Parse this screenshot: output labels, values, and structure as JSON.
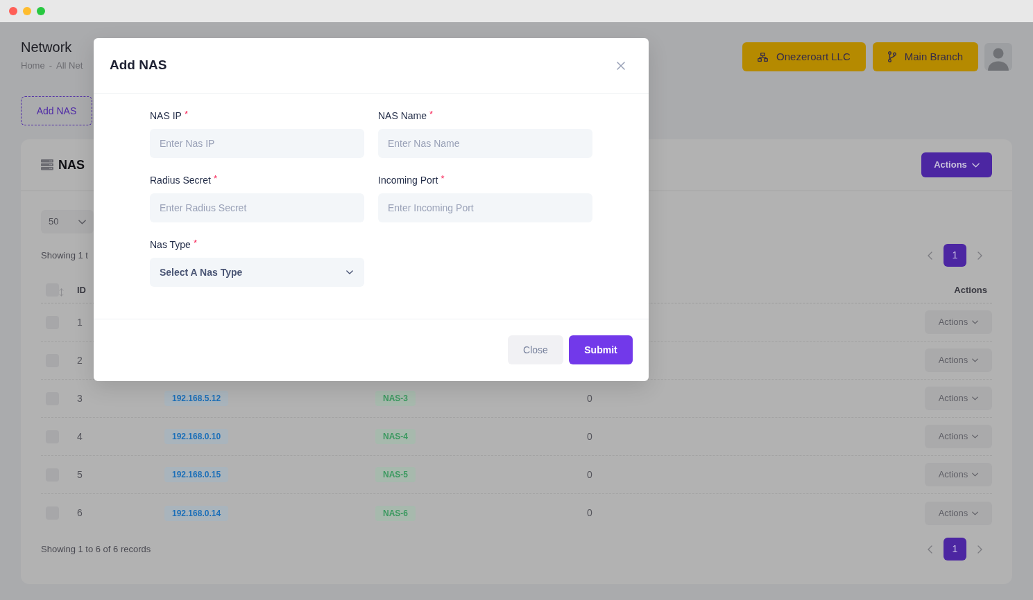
{
  "page": {
    "title": "Network",
    "breadcrumb": {
      "items": [
        "Home",
        "All Net"
      ],
      "separator": "-"
    }
  },
  "header_buttons": [
    {
      "label": "Onezeroart LLC"
    },
    {
      "label": "Main Branch"
    }
  ],
  "add_button": {
    "label": "Add NAS"
  },
  "card": {
    "title": "NAS",
    "actions_button": "Actions",
    "page_size": "50",
    "summary_top": "Showing 1 t",
    "pagination_top": [
      {
        "label": "1",
        "selected": true
      }
    ],
    "table": {
      "select_all_checked": false,
      "header": {
        "id": "ID",
        "actions": "Actions"
      },
      "rows": [
        {
          "id": "1",
          "checked": false,
          "actions": "Actions"
        },
        {
          "id": "2",
          "checked": false,
          "actions": "Actions"
        },
        {
          "id": "3",
          "checked": false,
          "column_3": "192.168.5.12",
          "column_4": "NAS-3",
          "column_5": "0",
          "actions": "Actions"
        },
        {
          "id": "4",
          "checked": false,
          "column_3": "192.168.0.10",
          "column_4": "NAS-4",
          "column_5": "0",
          "actions": "Actions"
        },
        {
          "id": "5",
          "checked": false,
          "column_3": "192.168.0.15",
          "column_4": "NAS-5",
          "column_5": "0",
          "actions": "Actions"
        },
        {
          "id": "6",
          "checked": false,
          "column_3": "192.168.0.14",
          "column_4": "NAS-6",
          "column_5": "0",
          "actions": "Actions"
        }
      ]
    },
    "summary_bottom": "Showing 1 to 6 of 6 records",
    "pagination_bottom": [
      {
        "label": "1",
        "selected": true
      }
    ]
  },
  "modal": {
    "title": "Add NAS",
    "fields": [
      {
        "kind": "input",
        "label": "NAS IP",
        "required_mark": "*",
        "placeholder": "Enter Nas IP"
      },
      {
        "kind": "input",
        "label": "NAS Name",
        "required_mark": "*",
        "placeholder": "Enter Nas Name"
      },
      {
        "kind": "input",
        "label": "Radius Secret",
        "required_mark": "*",
        "placeholder": "Enter Radius Secret"
      },
      {
        "kind": "input",
        "label": "Incoming Port",
        "required_mark": "*",
        "placeholder": "Enter Incoming Port"
      },
      {
        "kind": "select",
        "label": "Nas Type",
        "required_mark": "*",
        "value": "Select A Nas Type"
      }
    ],
    "buttons": [
      {
        "kind": "secondary",
        "label": "Close"
      },
      {
        "kind": "primary",
        "label": "Submit"
      }
    ]
  }
}
